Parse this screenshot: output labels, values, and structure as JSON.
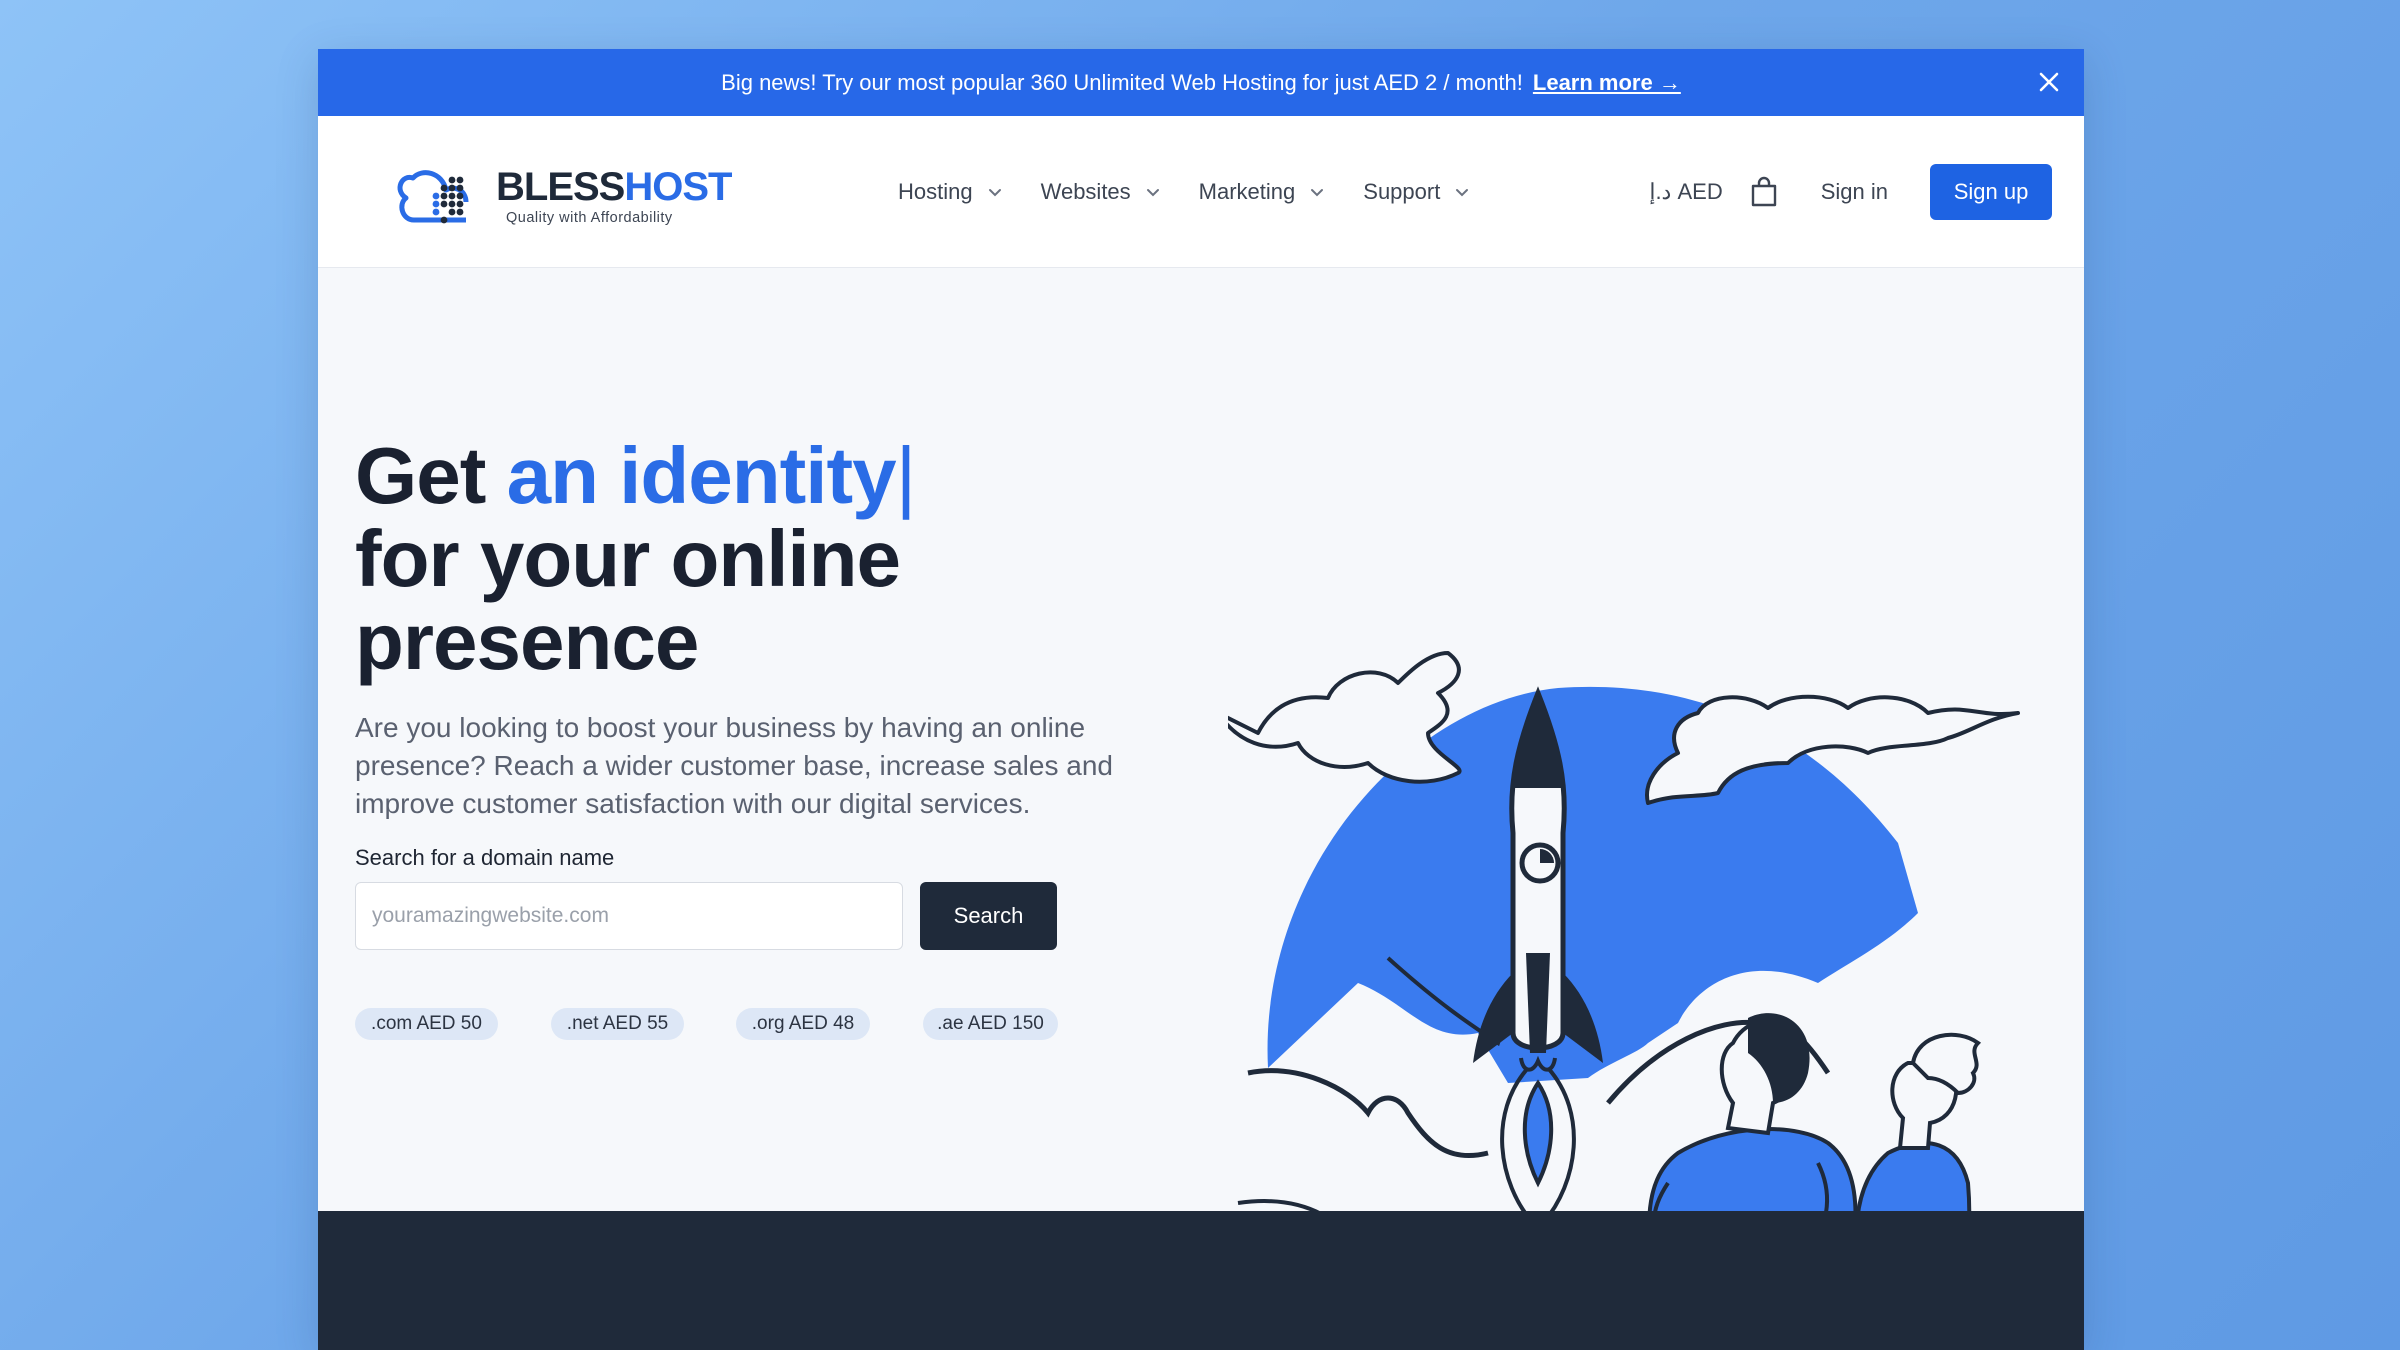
{
  "announcement": {
    "text": "Big news! Try our most popular 360 Unlimited Web Hosting for just AED 2 / month!",
    "link": "Learn more →"
  },
  "brand": {
    "name_part1": "BLESS",
    "name_part2": "HOST",
    "tagline": "Quality with Affordability"
  },
  "nav": [
    {
      "label": "Hosting"
    },
    {
      "label": "Websites"
    },
    {
      "label": "Marketing"
    },
    {
      "label": "Support"
    }
  ],
  "header_tools": {
    "currency": "د.إ AED",
    "signin": "Sign in",
    "signup": "Sign up"
  },
  "hero": {
    "title_lead": "Get ",
    "title_accent": "an identity",
    "title_caret": "|",
    "title_line2": "for your online",
    "title_line3": "presence",
    "subtitle": "Are you looking to boost your business by having an online presence? Reach a wider customer base, increase sales and improve customer satisfaction with our digital services."
  },
  "domain_search": {
    "label": "Search for a domain name",
    "placeholder": "youramazingwebsite.com",
    "button": "Search",
    "tlds": [
      {
        "label": ".com AED 50"
      },
      {
        "label": ".net AED 55"
      },
      {
        "label": ".org AED 48"
      },
      {
        "label": ".ae AED 150"
      }
    ]
  },
  "colors": {
    "primary": "#2768e8",
    "dark": "#1f2a3a",
    "background": "#f6f8fb"
  }
}
